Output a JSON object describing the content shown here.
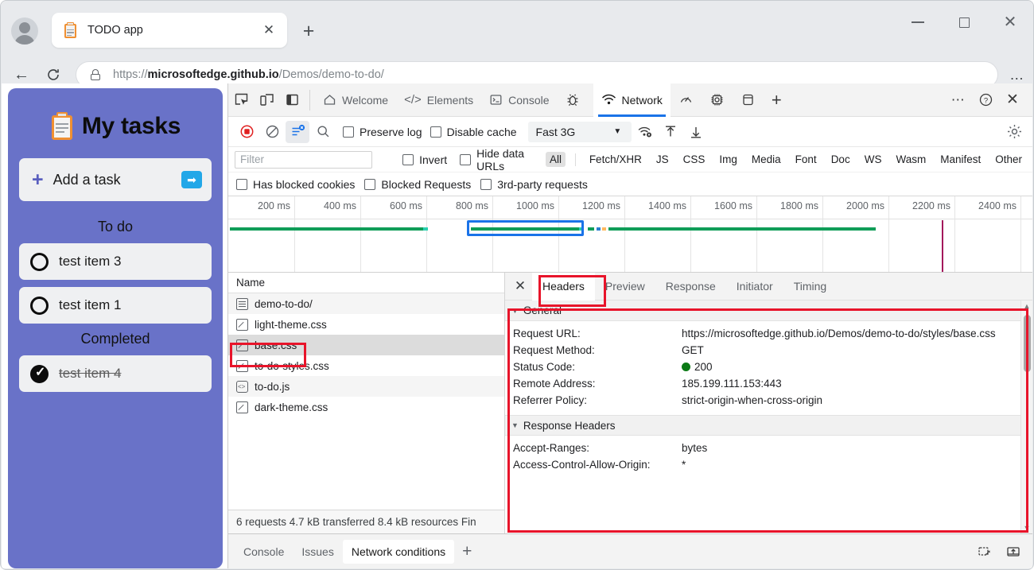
{
  "browser": {
    "tab": {
      "title": "TODO app",
      "favicon": "clipboard-icon",
      "close": "✕"
    },
    "new_tab": "+",
    "window_controls": {
      "minimize": "minimize-icon",
      "maximize": "maximize-icon",
      "close": "✕"
    },
    "nav": {
      "back": "←",
      "reload": "⟳",
      "more": "…"
    },
    "omnibox": {
      "lock": "lock-icon",
      "url_prefix": "https://",
      "url_domain": "microsoftedge.github.io",
      "url_path": "/Demos/demo-to-do/",
      "full_url": "https://microsoftedge.github.io/Demos/demo-to-do/"
    }
  },
  "webpage": {
    "title": "My tasks",
    "add_task": {
      "plus": "+",
      "label": "Add a task",
      "submit": "➡"
    },
    "sections": [
      {
        "label": "To do",
        "tasks": [
          {
            "text": "test item 3",
            "done": false
          },
          {
            "text": "test item 1",
            "done": false
          }
        ]
      },
      {
        "label": "Completed",
        "tasks": [
          {
            "text": "test item 4",
            "done": true
          }
        ]
      }
    ]
  },
  "devtools": {
    "left_icons": [
      "inspect-element-icon",
      "device-toolbar-icon",
      "dock-side-icon"
    ],
    "tabs": [
      {
        "label": "Welcome",
        "icon": "home-icon",
        "active": false
      },
      {
        "label": "Elements",
        "icon": "code-brackets-icon",
        "active": false
      },
      {
        "label": "Console",
        "icon": "console-prompt-icon",
        "active": false
      },
      {
        "label": "",
        "icon": "bug-icon",
        "active": false
      },
      {
        "label": "Network",
        "icon": "network-wifi-icon",
        "active": true
      },
      {
        "label": "",
        "icon": "performance-gauge-icon",
        "active": false
      },
      {
        "label": "",
        "icon": "memory-chip-icon",
        "active": false
      },
      {
        "label": "",
        "icon": "application-storage-icon",
        "active": false
      },
      {
        "label": "",
        "icon": "add-panel-plus-icon",
        "active": false
      }
    ],
    "right_icons": [
      "more-options-icon",
      "help-icon",
      "close-devtools-icon"
    ],
    "network_toolbar": {
      "record": "record-stop-icon",
      "clear": "clear-icon",
      "filter_toggle": "filter-icon",
      "search": "search-icon",
      "preserve_log": {
        "label": "Preserve log",
        "checked": false
      },
      "disable_cache": {
        "label": "Disable cache",
        "checked": false
      },
      "throttle": {
        "value": "Fast 3G",
        "caret": "▼"
      },
      "throttle_settings": "network-conditions-icon",
      "import_har": "import-har-icon",
      "export_har": "export-har-icon",
      "settings": "settings-gear-icon"
    },
    "filter_bar": {
      "placeholder": "Filter",
      "invert": {
        "label": "Invert",
        "checked": false
      },
      "hide_data_urls": {
        "label": "Hide data URLs",
        "checked": false
      },
      "types": [
        "All",
        "Fetch/XHR",
        "JS",
        "CSS",
        "Img",
        "Media",
        "Font",
        "Doc",
        "WS",
        "Wasm",
        "Manifest",
        "Other"
      ],
      "selected_type": "All"
    },
    "blocked_bar": [
      {
        "label": "Has blocked cookies",
        "checked": false
      },
      {
        "label": "Blocked Requests",
        "checked": false
      },
      {
        "label": "3rd-party requests",
        "checked": false
      }
    ],
    "overview": {
      "ticks": [
        "200 ms",
        "400 ms",
        "600 ms",
        "800 ms",
        "1000 ms",
        "1200 ms",
        "1400 ms",
        "1600 ms",
        "1800 ms",
        "2000 ms",
        "2200 ms",
        "2400 ms"
      ],
      "colors": {
        "bar": "#0f9d58",
        "selection": "#1a73e8",
        "marker": "#a3185b"
      }
    },
    "requests": {
      "column_header": "Name",
      "rows": [
        {
          "name": "demo-to-do/",
          "icon": "document-icon",
          "selected": false
        },
        {
          "name": "light-theme.css",
          "icon": "stylesheet-icon",
          "selected": false
        },
        {
          "name": "base.css",
          "icon": "stylesheet-icon",
          "selected": true
        },
        {
          "name": "to-do-styles.css",
          "icon": "stylesheet-icon",
          "selected": false
        },
        {
          "name": "to-do.js",
          "icon": "script-icon",
          "selected": false
        },
        {
          "name": "dark-theme.css",
          "icon": "stylesheet-icon",
          "selected": false
        }
      ],
      "status": "6 requests  4.7 kB transferred  8.4 kB resources  Fin"
    },
    "details": {
      "close": "✕",
      "tabs": [
        "Headers",
        "Preview",
        "Response",
        "Initiator",
        "Timing"
      ],
      "active_tab": "Headers",
      "sections": [
        {
          "title": "General",
          "rows": [
            {
              "key": "Request URL:",
              "value": "https://microsoftedge.github.io/Demos/demo-to-do/styles/base.css"
            },
            {
              "key": "Request Method:",
              "value": "GET"
            },
            {
              "key": "Status Code:",
              "value": "200",
              "status_dot": "#0b7a16"
            },
            {
              "key": "Remote Address:",
              "value": "185.199.111.153:443"
            },
            {
              "key": "Referrer Policy:",
              "value": "strict-origin-when-cross-origin"
            }
          ]
        },
        {
          "title": "Response Headers",
          "rows": [
            {
              "key": "Accept-Ranges:",
              "value": "bytes"
            },
            {
              "key": "Access-Control-Allow-Origin:",
              "value": "*"
            }
          ]
        }
      ]
    },
    "drawer": {
      "tabs": [
        {
          "label": "Console",
          "active": false
        },
        {
          "label": "Issues",
          "active": false
        },
        {
          "label": "Network conditions",
          "active": true
        }
      ],
      "add": "+",
      "right_icons": [
        "restore-drawer-icon",
        "dock-drawer-icon"
      ]
    }
  },
  "annotations": {
    "color": "#e8142a",
    "boxes": [
      "base-css-request-row",
      "headers-tab",
      "headers-detail-panel"
    ]
  }
}
